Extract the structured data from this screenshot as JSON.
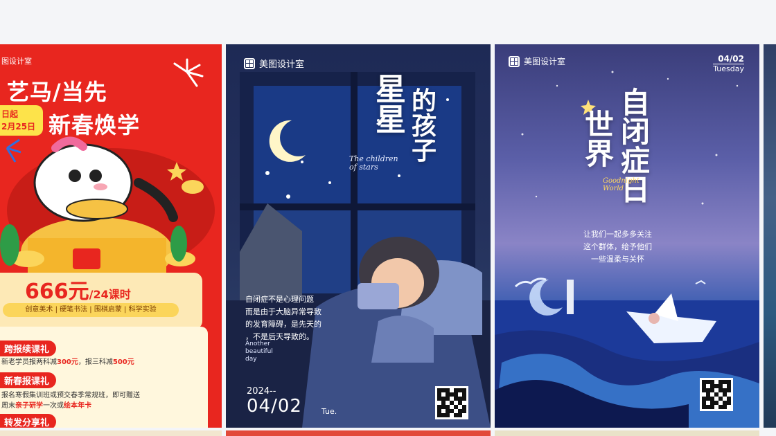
{
  "cards": [
    {
      "brand": "图设计室",
      "title_line1": "艺马/当先",
      "title_line2": "新春焕学",
      "date_badge": "日起\n2月25日",
      "price": "666元",
      "price_unit": "/24课时",
      "subjects": "创意美术 | 硬笔书法 | 围棋启蒙 | 科学实验",
      "offer1_title": "跨报续课礼",
      "offer1_text": "新老学员报两科减",
      "offer1_v1": "300元",
      "offer1_mid": "，报三科减",
      "offer1_v2": "500元",
      "offer2_title": "新春报课礼",
      "offer2_text1": "报名寒假集训班或预交春季常规班，即可赠送",
      "offer2_text2a": "周末",
      "offer2_hl1": "亲子研学",
      "offer2_text2b": "一次或",
      "offer2_hl2": "绘本年卡",
      "offer3_title": "转发分享礼"
    },
    {
      "brand": "美图设计室",
      "title_col1": "星星",
      "title_col2": "的孩子",
      "script": "The children\nof stars",
      "body": "自闭症不是心理问题\n而是由于大脑异常导致\n的发育障碍，是先天的\n，不是后天导致的。",
      "english": "Another\nbeautiful\nday",
      "year": "2024--",
      "date": "04/02",
      "weekday": "Tue."
    },
    {
      "brand": "美图设计室",
      "date": "04/02",
      "weekday": "Tuesday",
      "title_col1": "世界",
      "title_col2": "自闭症日",
      "script": "Goodnight\nWorld",
      "body": "让我们一起多多关注\n这个群体，给予他们\n一些温柔与关怀"
    }
  ],
  "colors": {
    "red": "#e8261f",
    "cream": "#fde9b6",
    "navy": "#1e2a55",
    "violet": "#5b5fa8"
  }
}
